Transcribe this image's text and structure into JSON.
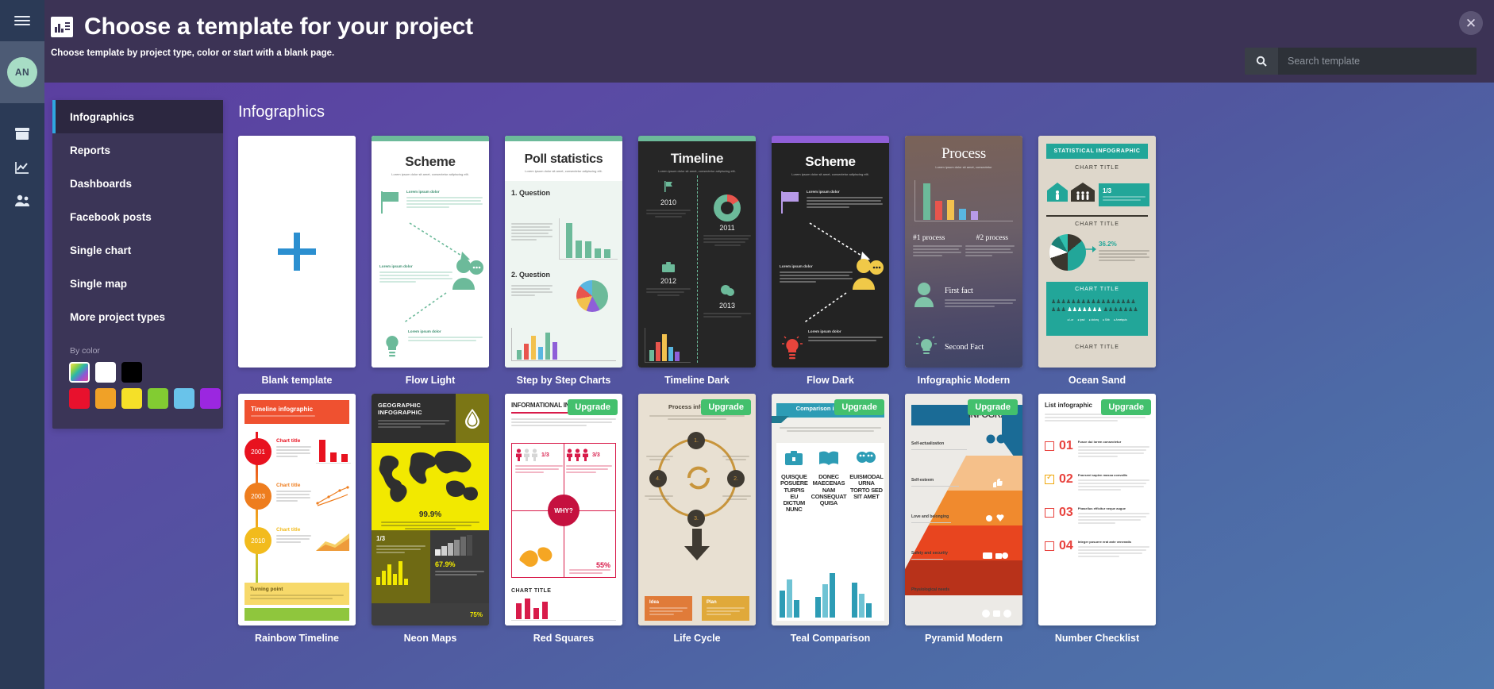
{
  "header": {
    "title": "Choose a template for your project",
    "subtitle": "Choose template by project type, color or start with a blank page.",
    "title_icon": "chart-document-icon",
    "close_icon": "close-icon"
  },
  "search": {
    "placeholder": "Search template",
    "value": "",
    "icon": "search-icon"
  },
  "rail": {
    "menu_icon": "hamburger-menu-icon",
    "avatar_initials": "AN",
    "icons": [
      "archive-box-icon",
      "analytics-chart-icon",
      "users-icon"
    ]
  },
  "sidebar": {
    "items": [
      {
        "label": "Infographics",
        "active": true
      },
      {
        "label": "Reports",
        "active": false
      },
      {
        "label": "Dashboards",
        "active": false
      },
      {
        "label": "Facebook posts",
        "active": false
      },
      {
        "label": "Single chart",
        "active": false
      },
      {
        "label": "Single map",
        "active": false
      },
      {
        "label": "More project types",
        "active": false
      }
    ],
    "by_color_label": "By color",
    "colors_row1": [
      "rainbow",
      "#ffffff",
      "#000000"
    ],
    "colors_row2": [
      "#e8112d",
      "#f0a127",
      "#f5e028",
      "#82cc32",
      "#69c3ea",
      "#9b27e0"
    ]
  },
  "main": {
    "section_title": "Infographics",
    "accent_color": "#2ea7e0",
    "upgrade_label": "Upgrade",
    "row1": [
      {
        "name": "Blank template",
        "kind": "blank",
        "upgrade": false
      },
      {
        "name": "Flow Light",
        "kind": "scheme-light",
        "upgrade": false,
        "thumb_title": "Scheme",
        "thumb_sub": "Lorem ipsum dolor sit amet, consectetur adipiscing elit.",
        "accent": "#6cba9a",
        "bg": "#ffffff"
      },
      {
        "name": "Step by Step Charts",
        "kind": "poll",
        "upgrade": false,
        "thumb_title": "Poll statistics",
        "thumb_sub": "Lorem ipsum dolor sit amet, consectetur adipiscing elit.",
        "q1": "1. Question",
        "q2": "2. Question",
        "accent": "#6cba9a",
        "bg": "#eef5f1"
      },
      {
        "name": "Timeline Dark",
        "kind": "timeline-dark",
        "upgrade": false,
        "thumb_title": "Timeline",
        "thumb_sub": "Lorem ipsum dolor sit amet, consectetur adipiscing elit.",
        "years": [
          "2010",
          "2011",
          "2012",
          "2013"
        ],
        "accent": "#6cba9a",
        "bg": "#262626"
      },
      {
        "name": "Flow Dark",
        "kind": "scheme-dark",
        "upgrade": false,
        "thumb_title": "Scheme",
        "thumb_sub": "Lorem ipsum dolor sit amet, consectetur adipiscing elit.",
        "accent": "#8f5fd8",
        "bg": "#232323"
      },
      {
        "name": "Infographic Modern",
        "kind": "process",
        "upgrade": false,
        "thumb_title": "Process",
        "thumb_sub": "Lorem ipsum dolor sit amet, consectetur",
        "p1": "#1 process",
        "p2": "#2 process",
        "f1": "First fact",
        "f2": "Second Fact",
        "accent": "#7fc4a8",
        "bg": "#6b5a56"
      },
      {
        "name": "Ocean Sand",
        "kind": "ocean-sand",
        "upgrade": false,
        "banner": "STATISTICAL INFOGRAPHIC",
        "chart_titles": [
          "CHART TITLE",
          "CHART TITLE",
          "CHART TITLE",
          "CHART TITLE"
        ],
        "ratio": "1/3",
        "pct": "36.2%",
        "accent": "#22a699",
        "bg": "#ded7cb"
      }
    ],
    "row2": [
      {
        "name": "Rainbow Timeline",
        "kind": "rainbow-timeline",
        "upgrade": false,
        "thumb_title": "Timeline infographic",
        "turning": "Turning point",
        "years": [
          "2001",
          "2003",
          "2010"
        ],
        "chart_label": "Chart title",
        "accent": "#ef5130",
        "bg": "#ffffff"
      },
      {
        "name": "Neon Maps",
        "kind": "neon-maps",
        "upgrade": false,
        "thumb_title": "GEOGRAPHIC INFOGRAPHIC",
        "pct": "99.9%",
        "pct2": "67.9%",
        "ratio": "1/3",
        "small_pct": "75%",
        "accent": "#f2e900",
        "bg": "#2f2f2f"
      },
      {
        "name": "Red Squares",
        "kind": "red-squares",
        "upgrade": true,
        "thumb_title": "INFORMATIONAL INFOGRAPHIC",
        "r1": "1/3",
        "r2": "3/3",
        "why": "WHY?",
        "pct": "55%",
        "chart_title": "CHART TITLE",
        "accent": "#d81b4a",
        "bg": "#ffffff"
      },
      {
        "name": "Life Cycle",
        "kind": "life-cycle",
        "upgrade": true,
        "thumb_title": "Process infographic",
        "steps": [
          "1.",
          "2.",
          "3.",
          "4."
        ],
        "left": "Idea",
        "right": "Plan",
        "accent": "#c8953c",
        "bg": "#e8e0d2"
      },
      {
        "name": "Teal Comparison",
        "kind": "teal-comparison",
        "upgrade": true,
        "thumb_title": "Comparison infographic",
        "cols": [
          "QUISQUE POSUERE TURPIS EU DICTUM NUNC",
          "DONEC MAECENAS NAM CONSEQUAT QUISA",
          "EUISMODAL URNA TORTO SED SIT AMET"
        ],
        "accent": "#2d9cb5",
        "bg": "#f0efeb"
      },
      {
        "name": "Pyramid Modern",
        "kind": "pyramid",
        "upgrade": true,
        "thumb_title": "HIERARCHY INFOGRAPHIC",
        "levels": [
          "Self-actualization",
          "Self-esteem",
          "Love and belonging",
          "Safety and security",
          "Physiological needs"
        ],
        "accent": "#1a6b96",
        "bg": "#eceae6"
      },
      {
        "name": "Number Checklist",
        "kind": "number-checklist",
        "upgrade": true,
        "thumb_title": "List infographic",
        "numbers": [
          "01",
          "02",
          "03",
          "04"
        ],
        "accent": "#e8413c",
        "bg": "#ffffff"
      }
    ]
  }
}
